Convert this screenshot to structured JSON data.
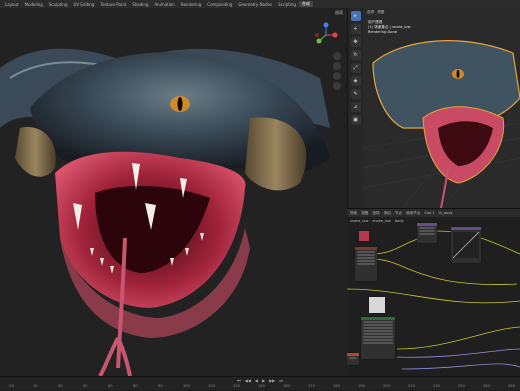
{
  "topbar": {
    "tabs": [
      "Layout",
      "Modeling",
      "Sculpting",
      "UV Editing",
      "Texture Paint",
      "Shading",
      "Animation",
      "Rendering",
      "Compositing",
      "Geometry Nodes",
      "Scripting",
      "合成"
    ],
    "active_tab_index": 11
  },
  "viewport": {
    "header_items": [
      "选项"
    ],
    "gizmo_axes": [
      "X",
      "Y",
      "Z"
    ]
  },
  "right_viewport": {
    "header_items": [
      "选项",
      "视图"
    ],
    "info_lines": [
      "用户透视",
      "(1) 场景集合 | snake_low",
      "Rendering Done"
    ]
  },
  "node_editor": {
    "header_items": [
      "物体",
      "视图",
      "选择",
      "添加",
      "节点",
      "使用节点",
      "Slot 1",
      "0l_body"
    ],
    "breadcrumb": [
      "snake_low",
      "snake_low",
      "body"
    ]
  },
  "timeline": {
    "ticks": [
      "-20",
      "10",
      "30",
      "50",
      "60",
      "80",
      "90",
      "100",
      "120",
      "130",
      "140",
      "160",
      "170",
      "180",
      "190",
      "200",
      "210",
      "230",
      "250",
      "260",
      "280"
    ],
    "frame": "1"
  },
  "colors": {
    "accent": "#4772b3",
    "selection_outline": "#e8a53a"
  }
}
